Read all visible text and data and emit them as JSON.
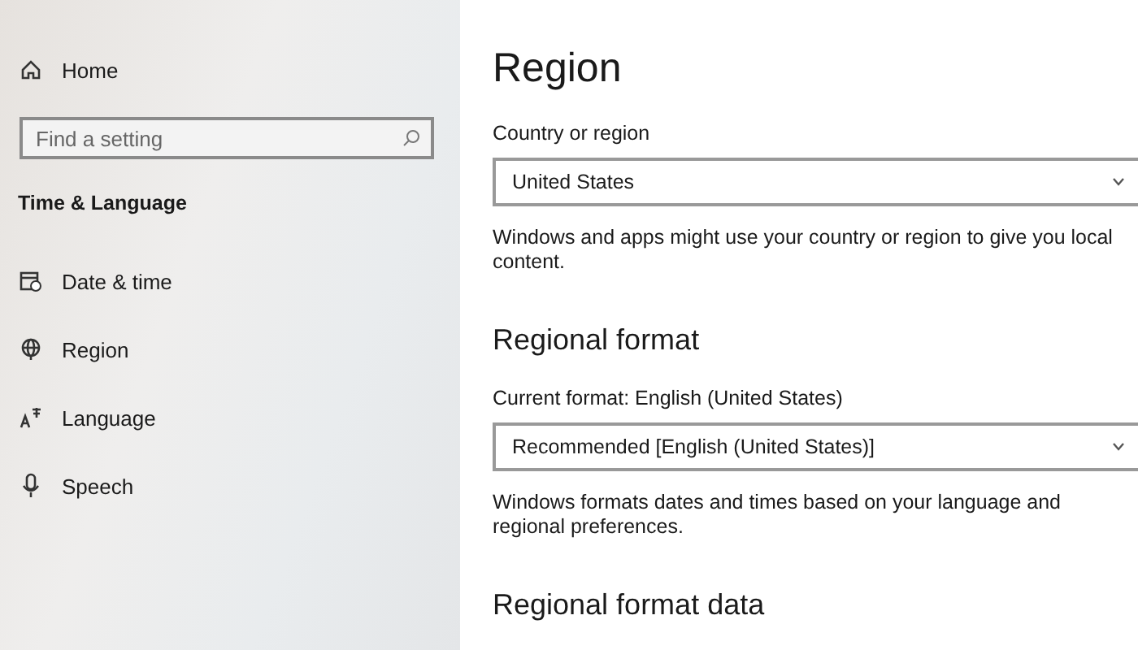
{
  "sidebar": {
    "home": "Home",
    "search": {
      "placeholder": "Find a setting"
    },
    "section": "Time & Language",
    "items": [
      {
        "kind": "calendar",
        "label": "Date & time"
      },
      {
        "kind": "globe",
        "label": "Region"
      },
      {
        "kind": "language",
        "label": "Language"
      },
      {
        "kind": "mic",
        "label": "Speech"
      }
    ]
  },
  "page": {
    "title": "Region",
    "sections": [
      {
        "label": "Country or region",
        "dropdown": "United States",
        "description": "Windows and apps might use your country or region to give you local content."
      },
      {
        "heading": "Regional format",
        "label": "Current format: English (United States)",
        "dropdown": "Recommended [English (United States)]",
        "description": "Windows formats dates and times based on your language and regional preferences."
      },
      {
        "heading": "Regional format data"
      }
    ]
  }
}
